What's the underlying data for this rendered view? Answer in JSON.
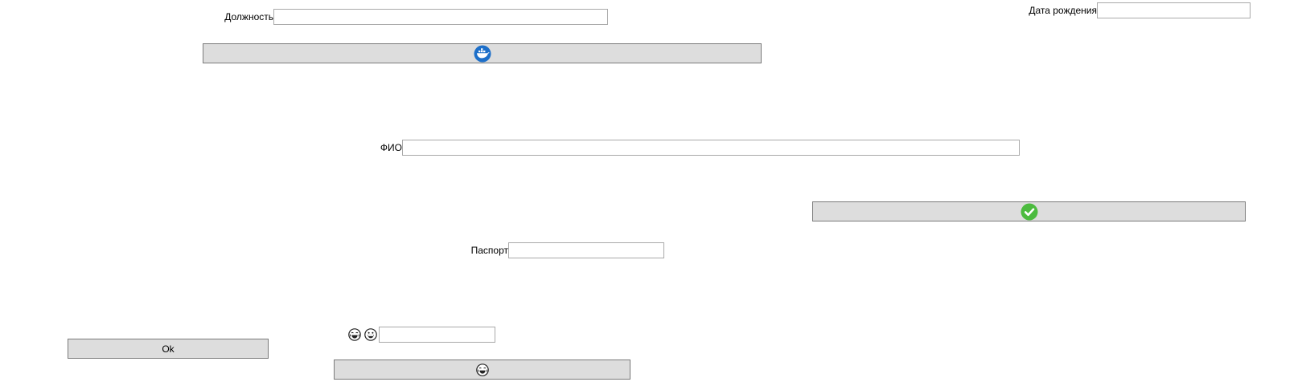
{
  "fields": {
    "position": {
      "label": "Должность",
      "value": ""
    },
    "birth_date": {
      "label": "Дата рождения",
      "value": ""
    },
    "full_name": {
      "label": "ФИО",
      "value": ""
    },
    "passport": {
      "label": "Паспорт",
      "value": ""
    },
    "emoji_field": {
      "value": ""
    }
  },
  "buttons": {
    "docker": {
      "icon": "docker-whale-icon"
    },
    "check": {
      "icon": "green-check-circle-icon"
    },
    "ok": {
      "label": "Ok"
    },
    "emoji": {
      "icon": "laughing-face-icon"
    }
  },
  "colors": {
    "docker_blue": "#1d6fc9",
    "check_green": "#4cbb3f",
    "button_bg": "#dddddd"
  }
}
